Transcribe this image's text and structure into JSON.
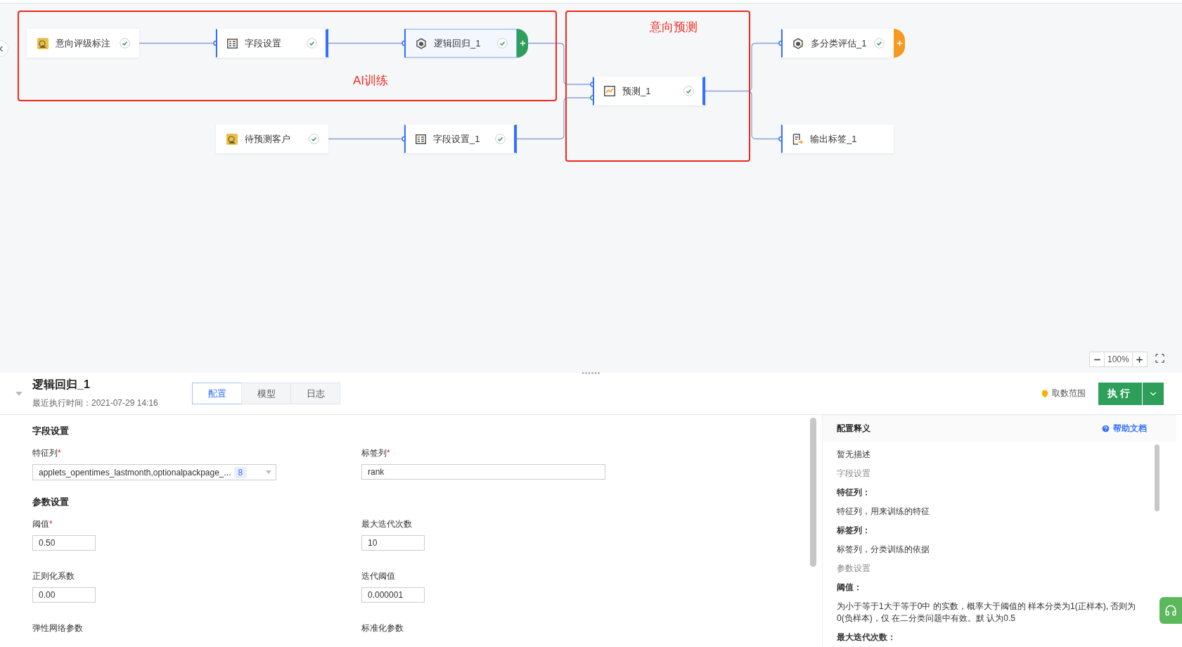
{
  "canvas": {
    "groups": [
      {
        "label": "AI训练"
      },
      {
        "label": "意向预测"
      }
    ],
    "nodes": [
      {
        "label": "意向评级标注",
        "kind": "dataset",
        "checked": true,
        "selected": false
      },
      {
        "label": "字段设置",
        "kind": "fields",
        "checked": true,
        "selected": false
      },
      {
        "label": "逻辑回归_1",
        "kind": "model",
        "checked": true,
        "selected": true,
        "handle": {
          "kind": "add",
          "color": "#2e9e5b"
        }
      },
      {
        "label": "多分类评估_1",
        "kind": "model",
        "checked": true,
        "selected": false,
        "handle": {
          "kind": "add",
          "color": "#f59a23"
        }
      },
      {
        "label": "预测_1",
        "kind": "predict",
        "checked": true,
        "selected": false
      },
      {
        "label": "待预测客户",
        "kind": "dataset",
        "checked": true,
        "selected": false
      },
      {
        "label": "字段设置_1",
        "kind": "fields",
        "checked": true,
        "selected": false
      },
      {
        "label": "输出标签_1",
        "kind": "output",
        "checked": false,
        "selected": false
      }
    ],
    "zoom": "100%"
  },
  "panel": {
    "title": "逻辑回归_1",
    "last_run": "最近执行时间：2021-07-29 14:16",
    "tabs": [
      {
        "label": "配置",
        "selected": true
      },
      {
        "label": "模型",
        "selected": false
      },
      {
        "label": "日志",
        "selected": false
      }
    ],
    "data_range": "取数范围",
    "run_button": "执行",
    "sections": [
      {
        "title": "字段设置",
        "fields": [
          {
            "label": "特征列",
            "required_mark": "*",
            "kind": "multiselect",
            "value": "applets_opentimes_lastmonth,optionalpackpage_...",
            "count": "8"
          },
          {
            "label": "标签列",
            "required_mark": "*",
            "kind": "text",
            "value": "rank"
          }
        ]
      },
      {
        "title": "参数设置",
        "fields": [
          {
            "label": "阈值",
            "required_mark": "*",
            "kind": "number",
            "value": "0.50"
          },
          {
            "label": "最大迭代次数",
            "kind": "number",
            "value": "10"
          },
          {
            "label": "正则化系数",
            "kind": "number",
            "value": "0.00"
          },
          {
            "label": "迭代阈值",
            "kind": "number",
            "value": "0.000001"
          },
          {
            "label": "弹性网络参数"
          },
          {
            "label": "标准化参数"
          }
        ]
      }
    ],
    "help": {
      "title": "配置释义",
      "link": "帮助文档",
      "items": [
        {
          "kind": "text",
          "text": "暂无描述"
        },
        {
          "kind": "section",
          "text": "字段设置"
        },
        {
          "kind": "term",
          "text": "特征列："
        },
        {
          "kind": "text",
          "text": "特征列，用来训练的特征"
        },
        {
          "kind": "term",
          "text": "标签列："
        },
        {
          "kind": "text",
          "text": "标签列，分类训练的依据"
        },
        {
          "kind": "section",
          "text": "参数设置"
        },
        {
          "kind": "term",
          "text": "阈值："
        },
        {
          "kind": "text",
          "text": "为小于等于1大于等于0中 的实数，概率大于阈值的 样本分类为1(正样本), 否则为 0(负样本)，仅 在二分类问题中有效。默 认为0.5"
        },
        {
          "kind": "term",
          "text": "最大迭代次数："
        }
      ]
    }
  }
}
